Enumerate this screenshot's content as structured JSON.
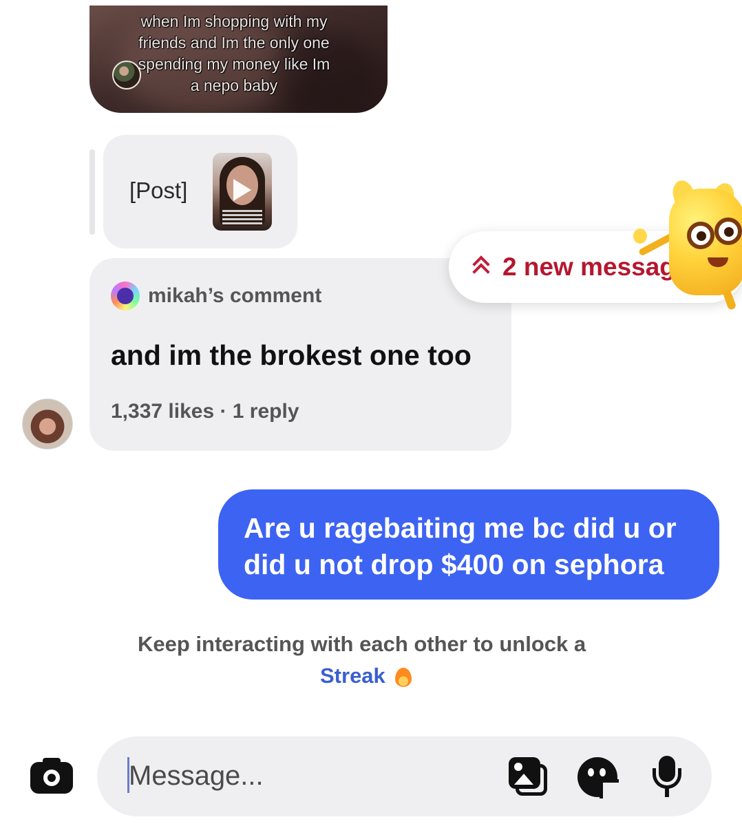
{
  "video_message": {
    "caption": "when Im shopping with my friends and Im the only one spending my money like Im a nepo baby"
  },
  "post_reply": {
    "label": "[Post]"
  },
  "comment_card": {
    "author": "mikah’s comment",
    "text": "and im the brokest one too",
    "meta": "1,337 likes · 1 reply"
  },
  "new_messages": {
    "label": "2 new messag"
  },
  "outgoing_message": {
    "text": "Are u ragebaiting me bc did u or did u not drop $400 on sephora",
    "bubble_color": "#3d63f2"
  },
  "streak": {
    "hint": "Keep interacting with each other to unlock a",
    "link": "Streak"
  },
  "composer": {
    "placeholder": "Message..."
  },
  "icons": [
    "camera-icon",
    "gallery-icon",
    "sticker-icon",
    "microphone-icon",
    "chevron-up-icon",
    "flame-icon"
  ],
  "colors": {
    "accent_red": "#b5172f",
    "link_blue": "#3b5ed0",
    "bubble_gray": "#efeff1"
  }
}
